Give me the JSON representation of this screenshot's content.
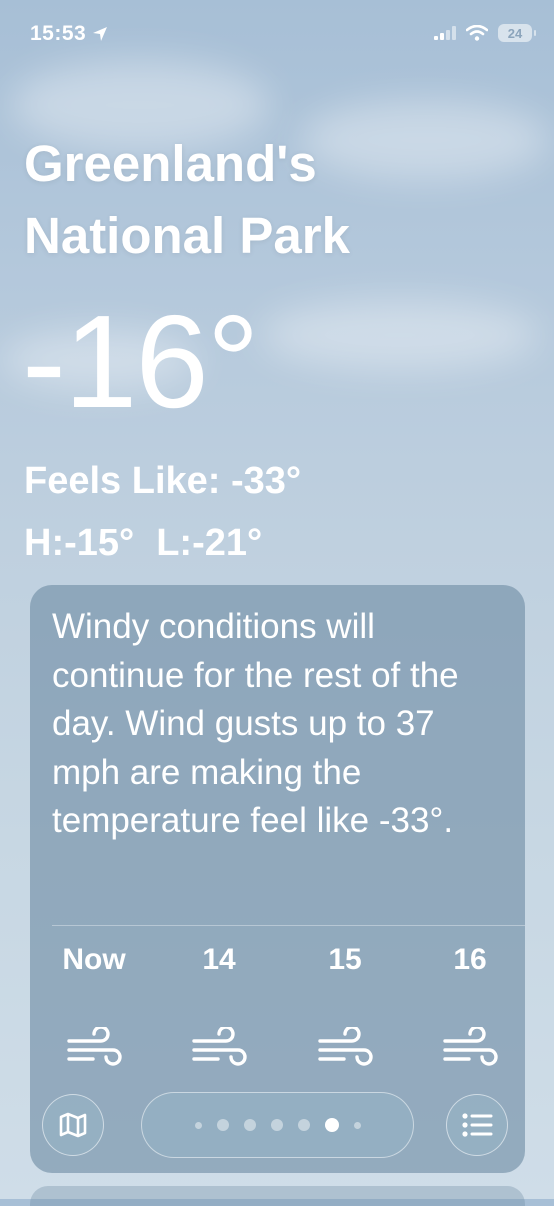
{
  "status_bar": {
    "time": "15:53",
    "battery": "24",
    "location_icon": "location-arrow-icon",
    "signal_icon": "cellular-signal-icon",
    "wifi_icon": "wifi-icon"
  },
  "weather": {
    "location": "Greenland's National Park",
    "temperature": "-16°",
    "feels_like": "Feels Like: -33°",
    "high": "H:-15°",
    "low": "L:-21°"
  },
  "card": {
    "summary": "Windy conditions will continue for the rest of the day. Wind gusts up to 37 mph are making the temperature feel like -33°.",
    "hours": [
      {
        "label": "Now",
        "icon": "wind-icon"
      },
      {
        "label": "14",
        "icon": "wind-icon"
      },
      {
        "label": "15",
        "icon": "wind-icon"
      },
      {
        "label": "16",
        "icon": "wind-icon"
      }
    ]
  },
  "toolbar": {
    "map_icon": "map-icon",
    "list_icon": "list-icon",
    "page_count": 6,
    "active_page": 5
  }
}
